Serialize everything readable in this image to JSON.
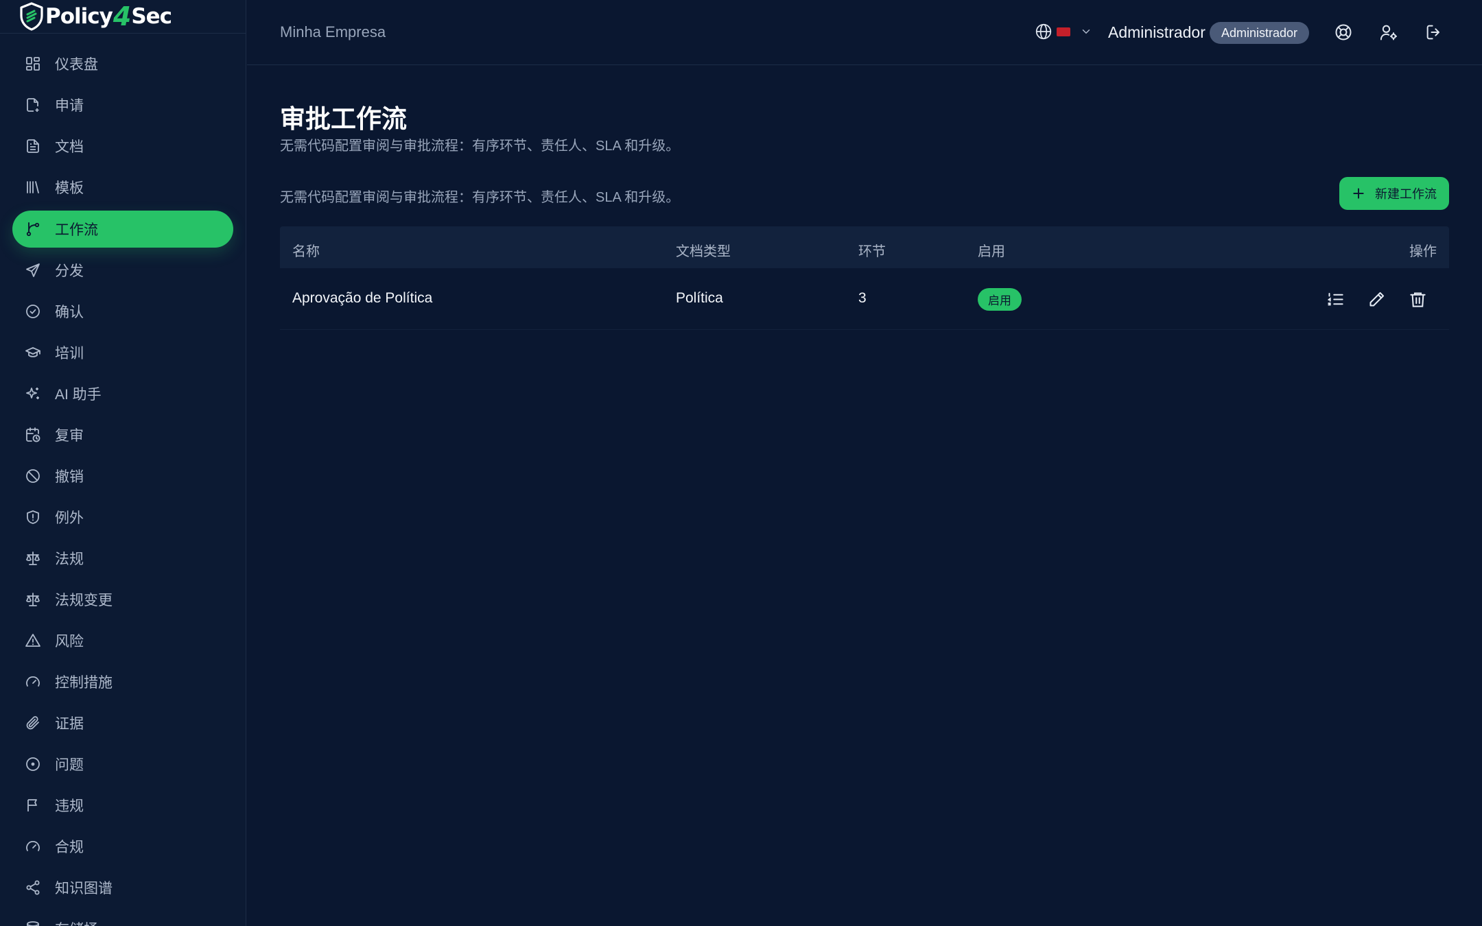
{
  "brand": {
    "name_left": "Policy",
    "name_four": "4",
    "name_right": "Sec"
  },
  "sidebar": {
    "items": [
      {
        "label": "仪表盘",
        "icon": "dashboard-icon"
      },
      {
        "label": "申请",
        "icon": "file-request-icon"
      },
      {
        "label": "文档",
        "icon": "document-icon"
      },
      {
        "label": "模板",
        "icon": "library-icon"
      },
      {
        "label": "工作流",
        "icon": "workflow-icon",
        "active": true
      },
      {
        "label": "分发",
        "icon": "send-icon"
      },
      {
        "label": "确认",
        "icon": "check-circle-icon"
      },
      {
        "label": "培训",
        "icon": "graduation-cap-icon"
      },
      {
        "label": "AI 助手",
        "icon": "sparkles-icon"
      },
      {
        "label": "复审",
        "icon": "calendar-clock-icon"
      },
      {
        "label": "撤销",
        "icon": "ban-icon"
      },
      {
        "label": "例外",
        "icon": "shield-alert-icon"
      },
      {
        "label": "法规",
        "icon": "scale-icon"
      },
      {
        "label": "法规变更",
        "icon": "scale-change-icon"
      },
      {
        "label": "风险",
        "icon": "warning-triangle-icon"
      },
      {
        "label": "控制措施",
        "icon": "gauge-icon"
      },
      {
        "label": "证据",
        "icon": "paperclip-icon"
      },
      {
        "label": "问题",
        "icon": "circle-dot-icon"
      },
      {
        "label": "违规",
        "icon": "flag-icon"
      },
      {
        "label": "合规",
        "icon": "gauge-icon"
      },
      {
        "label": "知识图谱",
        "icon": "share-nodes-icon"
      },
      {
        "label": "存储桶",
        "icon": "storage-icon"
      }
    ]
  },
  "header": {
    "company": "Minha Empresa",
    "user_name": "Administrador",
    "role": "Administrador",
    "language_flag_color": "#c4202a"
  },
  "main": {
    "title": "审批工作流",
    "subtitle": "无需代码配置审阅与审批流程：有序环节、责任人、SLA 和升级。",
    "section_description": "无需代码配置审阅与审批流程：有序环节、责任人、SLA 和升级。",
    "new_button": "新建工作流",
    "table": {
      "columns": [
        "名称",
        "文档类型",
        "环节",
        "启用",
        "操作"
      ],
      "rows": [
        {
          "name": "Aprovação de Política",
          "doc_type": "Política",
          "steps": "3",
          "enabled": "启用"
        }
      ]
    }
  },
  "colors": {
    "accent": "#27c267",
    "background": "#0a1730",
    "sidebar": "#0c1a33",
    "badge": "#4a5a78"
  }
}
